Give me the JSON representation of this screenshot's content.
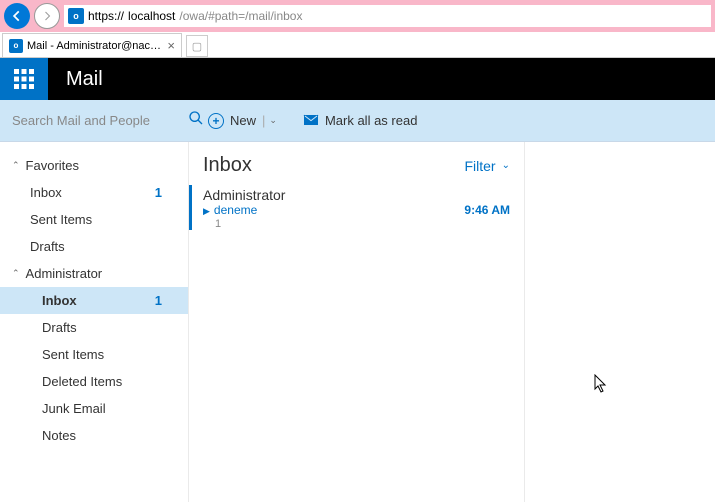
{
  "browser": {
    "url_scheme": "https://",
    "url_host": "localhost",
    "url_path": "/owa/#path=/mail/inbox",
    "tab_title": "Mail - Administrator@naca..."
  },
  "app": {
    "title": "Mail"
  },
  "search": {
    "placeholder": "Search Mail and People"
  },
  "toolbar": {
    "new_label": "New",
    "mark_all_label": "Mark all as read"
  },
  "sidebar": {
    "favorites_label": "Favorites",
    "favorites": [
      {
        "label": "Inbox",
        "count": "1"
      },
      {
        "label": "Sent Items",
        "count": ""
      },
      {
        "label": "Drafts",
        "count": ""
      }
    ],
    "account_label": "Administrator",
    "folders": [
      {
        "label": "Inbox",
        "count": "1",
        "selected": true
      },
      {
        "label": "Drafts",
        "count": ""
      },
      {
        "label": "Sent Items",
        "count": ""
      },
      {
        "label": "Deleted Items",
        "count": ""
      },
      {
        "label": "Junk Email",
        "count": ""
      },
      {
        "label": "Notes",
        "count": ""
      }
    ]
  },
  "list": {
    "title": "Inbox",
    "filter_label": "Filter",
    "messages": [
      {
        "from": "Administrator",
        "subject": "deneme",
        "time": "9:46 AM",
        "preview": "1"
      }
    ]
  }
}
